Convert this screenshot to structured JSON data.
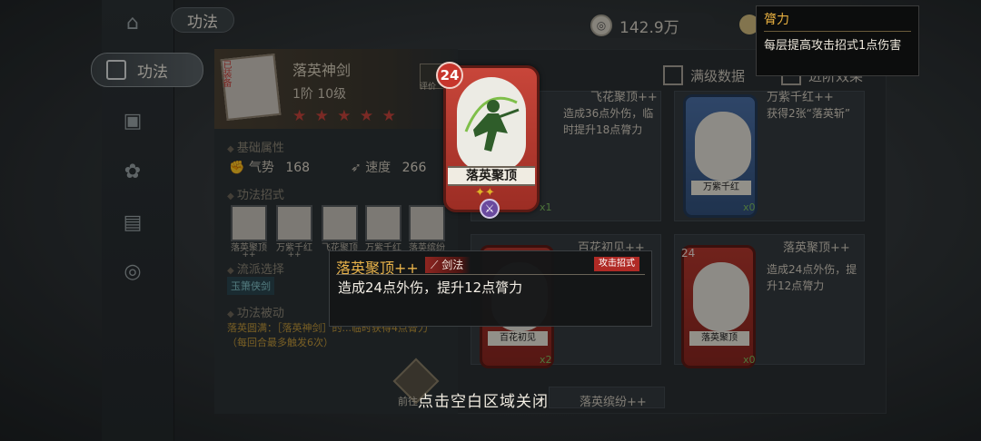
{
  "header": {
    "title": "功法",
    "currency_value": "142.9万"
  },
  "nav": {
    "active_label": "功法"
  },
  "buff_tooltip": {
    "title": "膂力",
    "description": "每层提高攻击招式1点伤害"
  },
  "skill": {
    "owned_tag": "已装备",
    "name": "落英神剑",
    "level": "1阶 10级",
    "stars": "★ ★ ★ ★ ★",
    "eval_label": "评价"
  },
  "base_attrs": {
    "heading": "基础属性",
    "qishi_label": "气势",
    "qishi_value": "168",
    "speed_label": "速度",
    "speed_value": "266"
  },
  "moves": {
    "heading": "功法招式",
    "items": [
      {
        "label": "落英聚顶",
        "plus": "++"
      },
      {
        "label": "万紫千红",
        "plus": "++"
      },
      {
        "label": "飞花聚顶",
        "plus": ""
      },
      {
        "label": "万紫千红",
        "plus": ""
      },
      {
        "label": "落英缤纷",
        "plus": ""
      }
    ]
  },
  "school": {
    "heading": "流派选择",
    "tag": "玉箫侠剑"
  },
  "passive": {
    "heading": "功法被动",
    "text": "落英圆满：［落英神剑］的...临时获得4点膂力（每回合最多触发6次）"
  },
  "options": {
    "max_data_label": "满级数据",
    "advance_label": "进阶效果"
  },
  "cards": [
    {
      "title": "飞花聚顶++",
      "desc": "造成36点外伤，临时提升18点膂力",
      "count": "x1",
      "color": "red"
    },
    {
      "title": "万紫千红++",
      "desc": "获得2张“落英斩”",
      "count": "x0",
      "color": "blue",
      "name": "万紫千红"
    },
    {
      "title": "百花初见++",
      "desc": "获得...",
      "count": "x2",
      "color": "red",
      "name": "百花初见"
    },
    {
      "title": "落英聚顶++",
      "desc": "造成24点外伤，提升12点膂力",
      "count": "x0",
      "color": "red",
      "cost": "24",
      "name": "落英聚顶"
    }
  ],
  "bottom_labels": {
    "prev": "前往",
    "bottom_card": "落英缤纷++"
  },
  "big_card": {
    "cost": "24",
    "name": "落英聚顶",
    "stars": "✦✦"
  },
  "tooltip": {
    "name": "落英聚顶++",
    "type": "剑法",
    "attack": "攻击招式",
    "desc": "造成24点外伤，提升12点膂力"
  },
  "close_hint": "点击空白区域关闭",
  "colors": {
    "gold": "#e9b34a",
    "card_red": "#b6382e",
    "card_blue": "#4c71a8"
  }
}
